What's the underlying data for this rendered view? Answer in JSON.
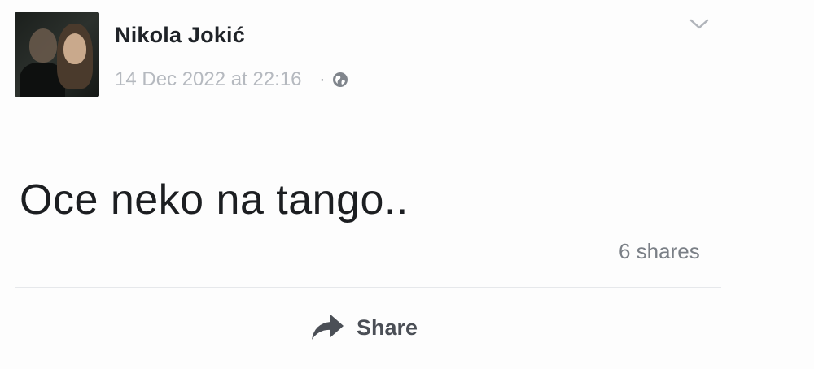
{
  "post": {
    "author": "Nikola Jokić",
    "timestamp": "14 Dec 2022 at 22:16",
    "separator": "·",
    "privacy_icon": "globe-icon",
    "menu_icon": "chevron-down-icon",
    "text": "Oce neko na tango..",
    "shares": "6 shares"
  },
  "actions": {
    "share_label": "Share",
    "share_icon": "share-arrow-icon"
  },
  "colors": {
    "author": "#1f2328",
    "timestamp": "#b5b9bf",
    "shares": "#7a7f86",
    "action": "#4b4f56",
    "divider": "#e6e8eb"
  }
}
